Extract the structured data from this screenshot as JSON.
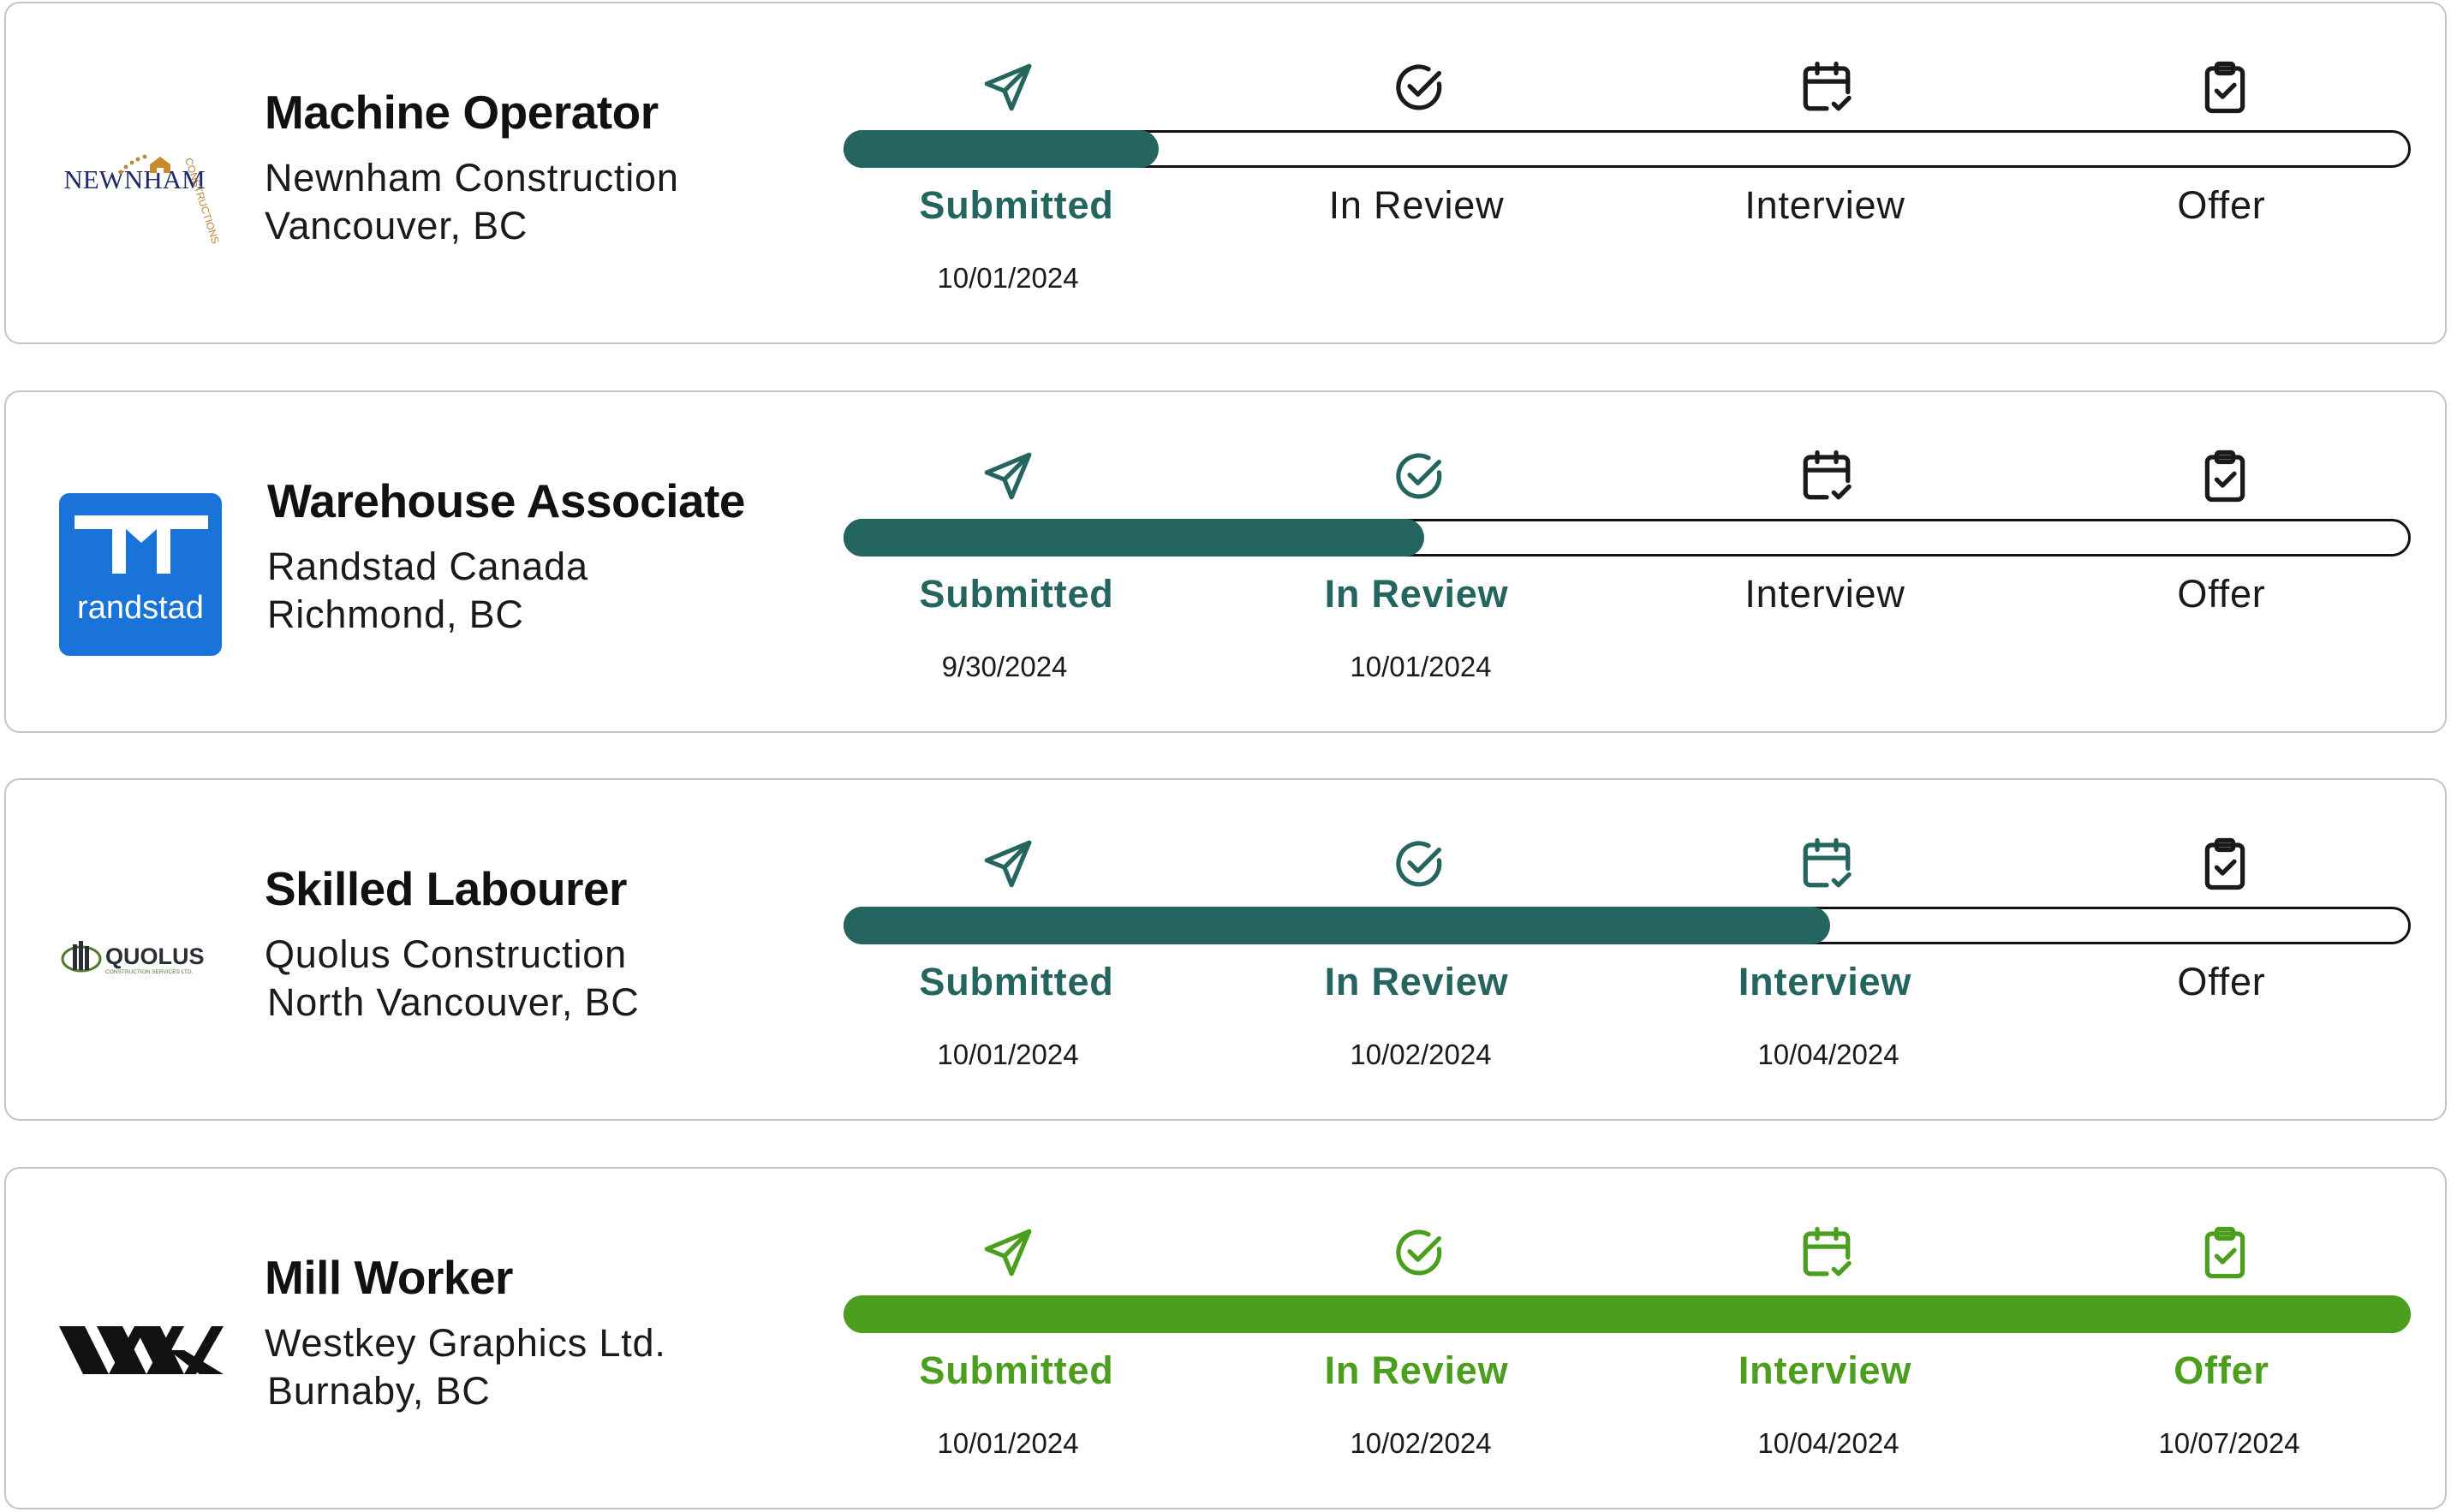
{
  "colors": {
    "in_progress": "#24665f",
    "complete": "#4b9e1e",
    "inactive": "#1a1a1a",
    "randstad_blue": "#1a73d8",
    "newnham_navy": "#1f2a6b",
    "newnham_gold": "#b8863b",
    "quolus_green": "#4f7a2a"
  },
  "stage_icons": [
    "paper-plane-icon",
    "check-circle-icon",
    "calendar-check-icon",
    "clipboard-check-icon"
  ],
  "applications": [
    {
      "title": "Machine Operator",
      "company": "Newnham Construction",
      "location": "Vancouver, BC",
      "logo": {
        "name": "newnham-logo",
        "wordmark": "NEWNHAM",
        "arc_text": "CONSTRUCTIONS"
      },
      "progress": 0.2,
      "complete": false,
      "stages": [
        {
          "label": "Submitted",
          "date": "10/01/2024",
          "done": true
        },
        {
          "label": "In Review",
          "date": "",
          "done": false
        },
        {
          "label": "Interview",
          "date": "",
          "done": false
        },
        {
          "label": "Offer",
          "date": "",
          "done": false
        }
      ]
    },
    {
      "title": "Warehouse Associate",
      "company": "Randstad Canada",
      "location": "Richmond, BC",
      "logo": {
        "name": "randstad-logo",
        "wordmark": "randstad"
      },
      "progress": 0.37,
      "complete": false,
      "stages": [
        {
          "label": "Submitted",
          "date": "9/30/2024",
          "done": true
        },
        {
          "label": "In Review",
          "date": "10/01/2024",
          "done": true
        },
        {
          "label": "Interview",
          "date": "",
          "done": false
        },
        {
          "label": "Offer",
          "date": "",
          "done": false
        }
      ]
    },
    {
      "title": "Skilled Labourer",
      "company": "Quolus Construction",
      "location": "North Vancouver, BC",
      "logo": {
        "name": "quolus-logo",
        "wordmark": "QUOLUS",
        "tagline": "CONSTRUCTION SERVICES LTD."
      },
      "progress": 0.63,
      "complete": false,
      "stages": [
        {
          "label": "Submitted",
          "date": "10/01/2024",
          "done": true
        },
        {
          "label": "In Review",
          "date": "10/02/2024",
          "done": true
        },
        {
          "label": "Interview",
          "date": "10/04/2024",
          "done": true
        },
        {
          "label": "Offer",
          "date": "",
          "done": false
        }
      ]
    },
    {
      "title": "Mill Worker",
      "company": "Westkey Graphics Ltd.",
      "location": "Burnaby, BC",
      "logo": {
        "name": "westkey-logo"
      },
      "progress": 1.0,
      "complete": true,
      "stages": [
        {
          "label": "Submitted",
          "date": "10/01/2024",
          "done": true
        },
        {
          "label": "In Review",
          "date": "10/02/2024",
          "done": true
        },
        {
          "label": "Interview",
          "date": "10/04/2024",
          "done": true
        },
        {
          "label": "Offer",
          "date": "10/07/2024",
          "done": true
        }
      ]
    }
  ]
}
